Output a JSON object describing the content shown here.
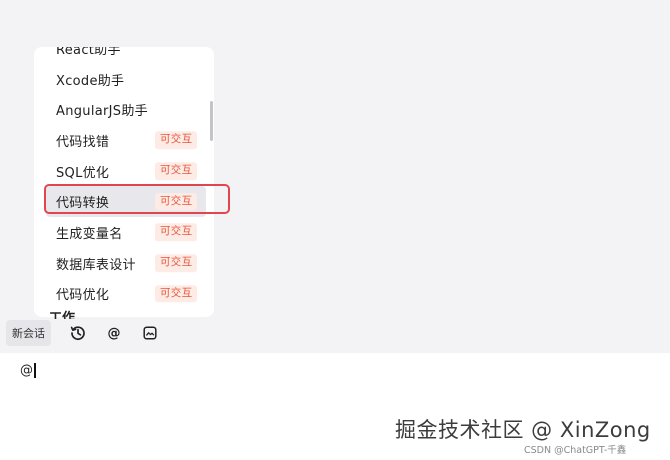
{
  "assistant_list": {
    "items": [
      {
        "label": "React助手",
        "badge": ""
      },
      {
        "label": "Xcode助手",
        "badge": ""
      },
      {
        "label": "AngularJS助手",
        "badge": ""
      },
      {
        "label": "代码找错",
        "badge": "可交互"
      },
      {
        "label": "SQL优化",
        "badge": "可交互"
      },
      {
        "label": "代码转换",
        "badge": "可交互"
      },
      {
        "label": "生成变量名",
        "badge": "可交互"
      },
      {
        "label": "数据库表设计",
        "badge": "可交互"
      },
      {
        "label": "代码优化",
        "badge": "可交互"
      }
    ],
    "next_section_title": "工作"
  },
  "toolbar": {
    "new_chat_label": "新会话",
    "mention_symbol": "@",
    "icons": [
      "history-icon",
      "at-icon",
      "image-icon"
    ]
  },
  "input": {
    "value": "@"
  },
  "watermark": {
    "main": "掘金技术社区 @ XinZong",
    "sub": "CSDN @ChatGPT-千鑫"
  },
  "colors": {
    "badge_text": "#e8543a",
    "badge_bg": "#fdece6",
    "highlight_border": "#e0474c",
    "selected_bg": "#e8e8ec"
  }
}
